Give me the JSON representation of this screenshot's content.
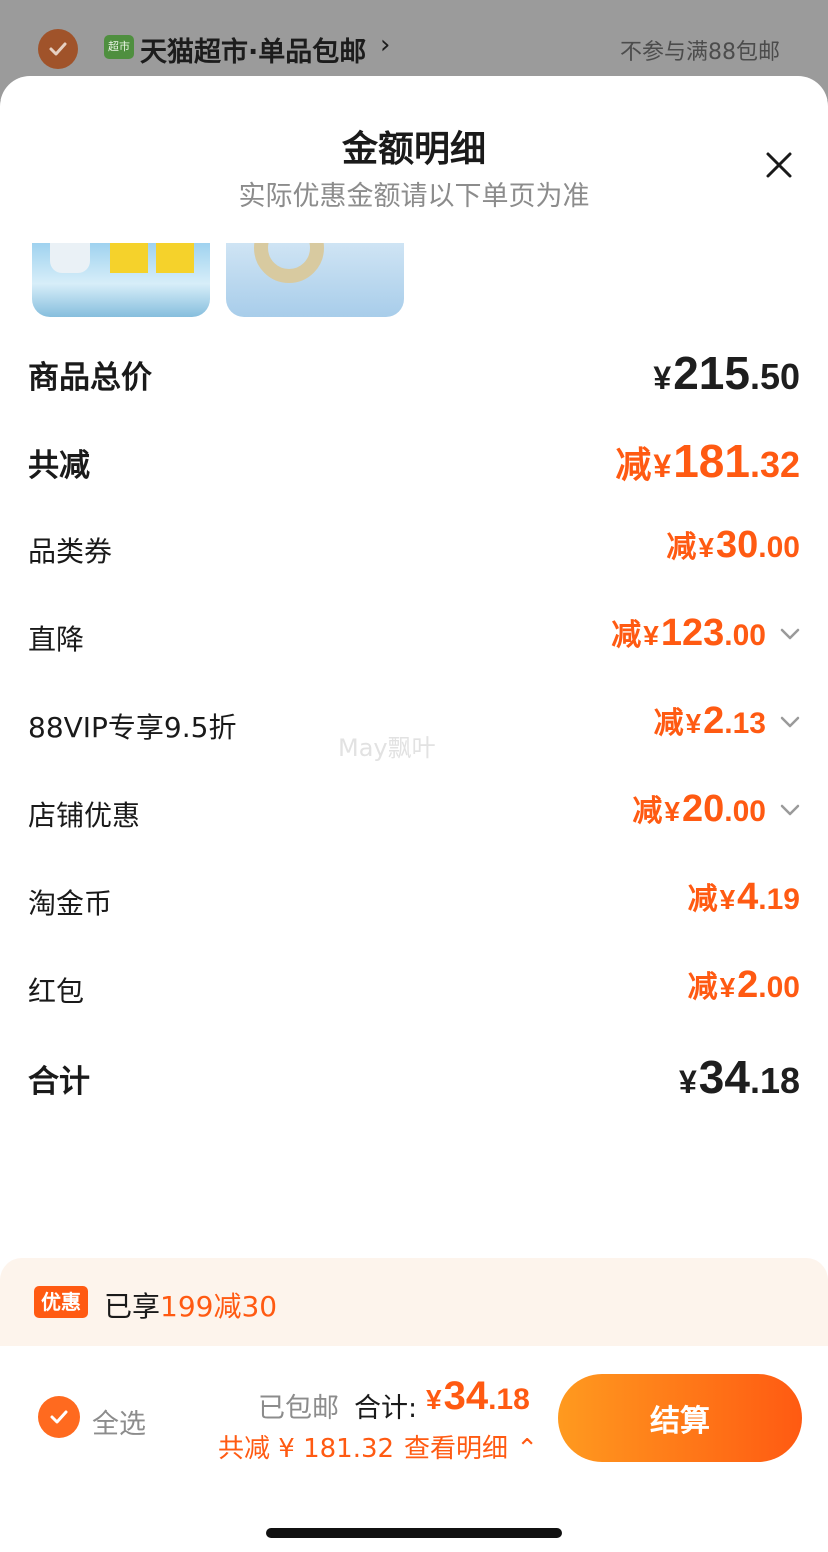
{
  "shop": {
    "badge": "超市",
    "name": "天猫超市·单品包邮",
    "arrow": "›",
    "note": "不参与满88包邮"
  },
  "sheet": {
    "title": "金额明细",
    "subtitle": "实际优惠金额请以下单页为准",
    "close_icon": "close-icon"
  },
  "rows": [
    {
      "label": "商品总价",
      "prefix": "",
      "yen": "¥",
      "int": "215",
      "dec": ".50",
      "color": "#1e1e1e",
      "chevron": false
    },
    {
      "label": "共减",
      "prefix": "减",
      "yen": "¥",
      "int": "181",
      "dec": ".32",
      "color": "#ff5a12",
      "chevron": false
    },
    {
      "label": "品类券",
      "prefix": "减",
      "yen": "¥",
      "int": "30",
      "dec": ".00",
      "color": "#ff5a12",
      "chevron": false
    },
    {
      "label": "直降",
      "prefix": "减",
      "yen": "¥",
      "int": "123",
      "dec": ".00",
      "color": "#ff5a12",
      "chevron": true
    },
    {
      "label": "88VIP专享9.5折",
      "prefix": "减",
      "yen": "¥",
      "int": "2",
      "dec": ".13",
      "color": "#ff5a12",
      "chevron": true
    },
    {
      "label": "店铺优惠",
      "prefix": "减",
      "yen": "¥",
      "int": "20",
      "dec": ".00",
      "color": "#ff5a12",
      "chevron": true
    },
    {
      "label": "淘金币",
      "prefix": "减",
      "yen": "¥",
      "int": "4",
      "dec": ".19",
      "color": "#ff5a12",
      "chevron": false
    },
    {
      "label": "红包",
      "prefix": "减",
      "yen": "¥",
      "int": "2",
      "dec": ".00",
      "color": "#ff5a12",
      "chevron": false
    },
    {
      "label": "合计",
      "prefix": "",
      "yen": "¥",
      "int": "34",
      "dec": ".18",
      "color": "#1e1e1e",
      "chevron": false
    }
  ],
  "watermark": "May飘叶",
  "promo": {
    "tag": "优惠",
    "text_prefix": "已享",
    "highlight": "199减30"
  },
  "bottom": {
    "select_all": "全选",
    "shipping": "已包邮",
    "total_label": "合计:",
    "total_yen": "¥",
    "total_int": "34",
    "total_dec": ".18",
    "saved": "共减 ¥ 181.32",
    "detail_link": "查看明细 ⌃",
    "checkout": "结算"
  },
  "colors": {
    "accent": "#ff5a12",
    "accent_light": "#ff9a1f",
    "promo_bg": "#fdf4ec"
  }
}
